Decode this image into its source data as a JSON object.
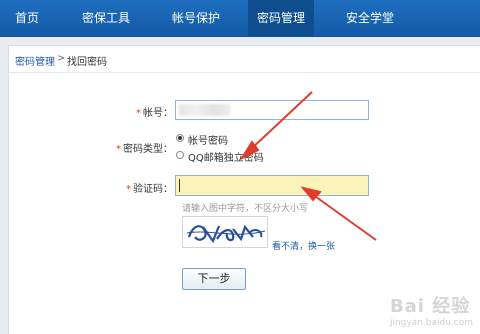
{
  "nav": {
    "items": [
      {
        "label": "首页",
        "active": false
      },
      {
        "label": "密保工具",
        "active": false
      },
      {
        "label": "帐号保护",
        "active": false
      },
      {
        "label": "密码管理",
        "active": true
      },
      {
        "label": "安全学堂",
        "active": false
      }
    ]
  },
  "breadcrumb": {
    "link": "密码管理",
    "separator": ">",
    "current": "找回密码"
  },
  "form": {
    "account_label": "帐号：",
    "type_label": "密码类型：",
    "type_options": [
      {
        "label": "帐号密码",
        "checked": true
      },
      {
        "label": "QQ邮箱独立密码",
        "checked": false
      }
    ],
    "captcha_label": "验证码：",
    "captcha_hint": "请输入图中字符，不区分大小写",
    "refresh_link": "看不清，换一张",
    "next_button": "下一步",
    "required_mark": "*"
  },
  "watermark": {
    "brand": "Bai 经验",
    "url": "jingyan.baidu.com"
  },
  "colors": {
    "nav_bg": "#145aa6",
    "nav_active": "#0e4d8e",
    "link": "#1a5aa6",
    "required": "#e23a1b",
    "captcha_input_bg": "#fbf3b9",
    "arrow": "#e03c2e"
  }
}
